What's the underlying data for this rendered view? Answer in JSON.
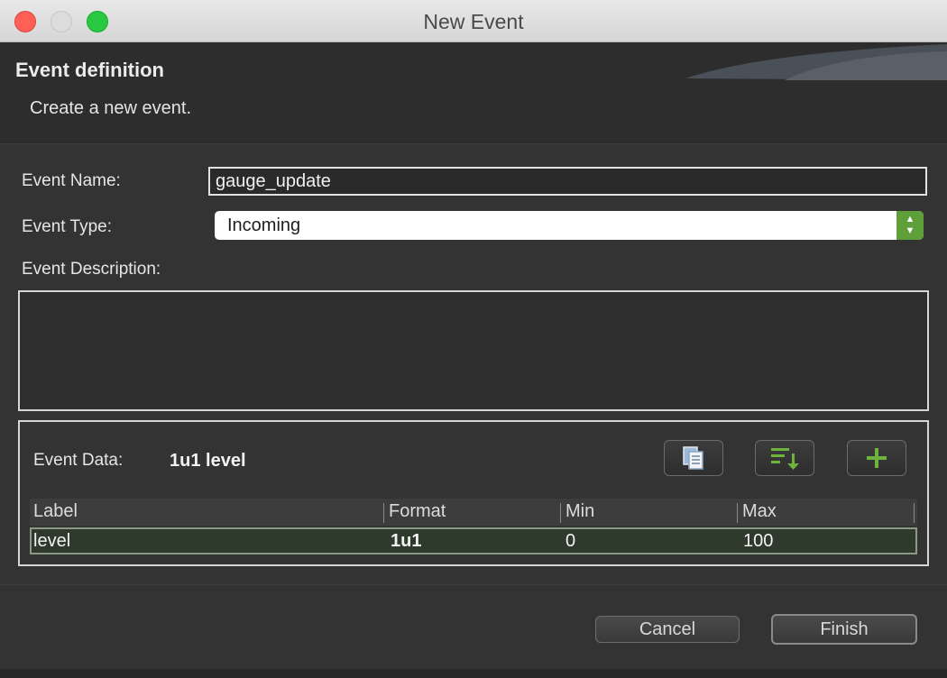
{
  "window": {
    "title": "New Event"
  },
  "header": {
    "title": "Event definition",
    "subtitle": "Create a new event."
  },
  "form": {
    "name_label": "Event Name:",
    "name_value": "gauge_update",
    "type_label": "Event Type:",
    "type_value": "Incoming",
    "description_label": "Event Description:",
    "description_value": ""
  },
  "event_data": {
    "label": "Event Data:",
    "value": "1u1 level",
    "tools": [
      {
        "icon": "paste-icon"
      },
      {
        "icon": "sort-icon"
      },
      {
        "icon": "add-icon"
      }
    ],
    "columns": [
      "Label",
      "Format",
      "Min",
      "Max"
    ],
    "rows": [
      {
        "label": "level",
        "format": "1u1",
        "min": "0",
        "max": "100"
      }
    ]
  },
  "buttons": {
    "cancel": "Cancel",
    "finish": "Finish"
  },
  "colors": {
    "accent_green": "#5f9f3a",
    "selected_row": "#2e3a2b"
  }
}
